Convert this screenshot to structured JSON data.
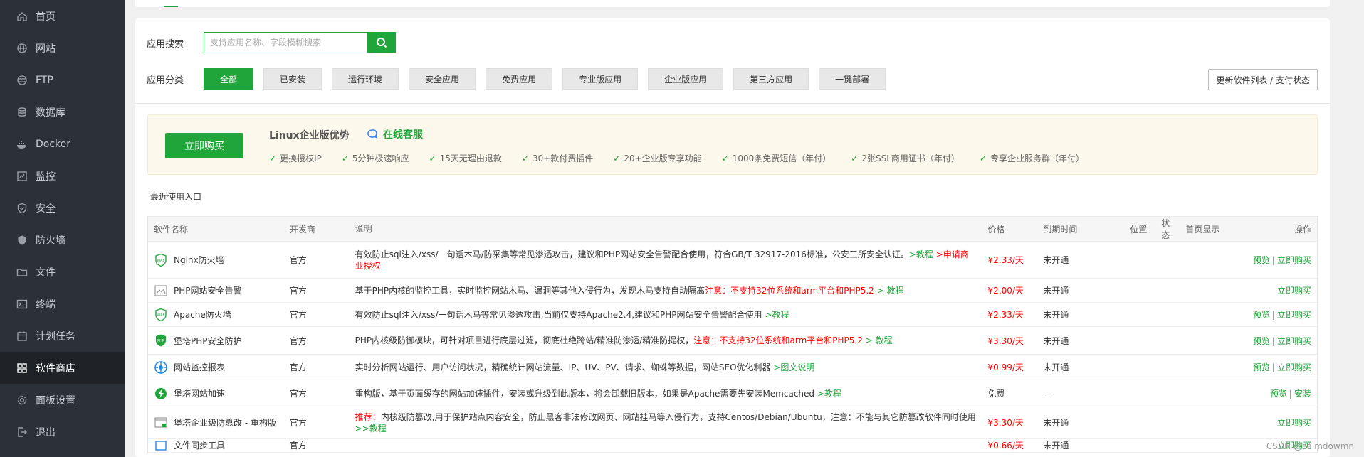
{
  "sidebar": {
    "items": [
      {
        "label": "首页",
        "icon": "home-icon"
      },
      {
        "label": "网站",
        "icon": "globe-icon"
      },
      {
        "label": "FTP",
        "icon": "ftp-icon"
      },
      {
        "label": "数据库",
        "icon": "database-icon"
      },
      {
        "label": "Docker",
        "icon": "docker-icon"
      },
      {
        "label": "监控",
        "icon": "monitor-icon"
      },
      {
        "label": "安全",
        "icon": "shield-icon"
      },
      {
        "label": "防火墙",
        "icon": "firewall-icon"
      },
      {
        "label": "文件",
        "icon": "folder-icon"
      },
      {
        "label": "终端",
        "icon": "terminal-icon"
      },
      {
        "label": "计划任务",
        "icon": "calendar-icon"
      },
      {
        "label": "软件商店",
        "icon": "apps-icon",
        "active": true
      },
      {
        "label": "面板设置",
        "icon": "gear-icon"
      },
      {
        "label": "退出",
        "icon": "logout-icon"
      }
    ]
  },
  "search": {
    "label": "应用搜索",
    "placeholder": "支持应用名称、字段模糊搜索"
  },
  "categories": {
    "label": "应用分类",
    "items": [
      "全部",
      "已安装",
      "运行环境",
      "安全应用",
      "免费应用",
      "专业版应用",
      "企业版应用",
      "第三方应用",
      "一键部署"
    ],
    "active": "全部"
  },
  "refresh_label": "更新软件列表 / 支付状态",
  "promo": {
    "buy_label": "立即购买",
    "title": "Linux企业版优势",
    "online_service": "在线客服",
    "features": [
      "更换授权IP",
      "5分钟极速响应",
      "15天无理由退款",
      "30+款付费插件",
      "20+企业版专享功能",
      "1000条免费短信（年付）",
      "2张SSL商用证书（年付）",
      "专享企业服务群（年付）"
    ]
  },
  "recent_label": "最近使用入口",
  "table": {
    "headers": {
      "name": "软件名称",
      "dev": "开发商",
      "desc": "说明",
      "price": "价格",
      "expire": "到期时间",
      "position": "位置",
      "status": "状态",
      "home": "首页显示",
      "ops": "操作"
    },
    "rows": [
      {
        "name": "Nginx防火墙",
        "icon": "waf-icon",
        "dev": "官方",
        "desc": "有效防止sql注入/xss/一句话木马/防采集等常见渗透攻击，建议和PHP网站安全告警配合使用，符合GB/T 32917-2016标准，公安三所安全认证。",
        "desc_green": ">教程",
        "desc_red": ">申请商业授权",
        "price": "¥2.33/天",
        "expire": "未开通",
        "ops": [
          "预览",
          "立即购买"
        ]
      },
      {
        "name": "PHP网站安全告警",
        "icon": "broken-image-icon",
        "dev": "官方",
        "desc": "基于PHP内核的监控工具，实时监控网站木马、漏洞等其他入侵行为，发现木马支持自动隔离",
        "desc_red": "注意：不支持32位系统和arm平台和PHP5.2",
        "desc_green": "> 教程",
        "price": "¥2.00/天",
        "expire": "未开通",
        "ops": [
          "立即购买"
        ]
      },
      {
        "name": "Apache防火墙",
        "icon": "waf-icon",
        "dev": "官方",
        "desc": "有效防止sql注入/xss/一句话木马等常见渗透攻击,当前仅支持Apache2.4,建议和PHP网站安全告警配合使用",
        "desc_green": ">教程",
        "price": "¥2.33/天",
        "expire": "未开通",
        "ops": [
          "预览",
          "立即购买"
        ]
      },
      {
        "name": "堡塔PHP安全防护",
        "icon": "php-shield-icon",
        "dev": "官方",
        "desc": "PHP内核级防御模块，可针对项目进行底层过滤，彻底杜绝跨站/精准防渗透/精准防提权，",
        "desc_red": "注意：不支持32位系统和arm平台和PHP5.2",
        "desc_green": "> 教程",
        "price": "¥3.30/天",
        "expire": "未开通",
        "ops": [
          "预览",
          "立即购买"
        ]
      },
      {
        "name": "网站监控报表",
        "icon": "report-icon",
        "dev": "官方",
        "desc": "实时分析网站运行、用户访问状况，精确统计网站流量、IP、UV、PV、请求、蜘蛛等数据，网站SEO优化利器",
        "desc_green": ">图文说明",
        "price": "¥0.99/天",
        "expire": "未开通",
        "ops": [
          "预览",
          "立即购买"
        ]
      },
      {
        "name": "堡塔网站加速",
        "icon": "bolt-icon",
        "dev": "官方",
        "desc": "重构版，基于页面缓存的网站加速插件，安装或升级到此版本，将会卸载旧版本，如果是Apache需要先安装Memcached",
        "desc_green": ">教程",
        "price": "免费",
        "expire": "--",
        "ops": [
          "预览",
          "安装"
        ]
      },
      {
        "name": "堡塔企业级防篡改 - 重构版",
        "icon": "tamper-icon",
        "dev": "官方",
        "desc_red_prefix": "推荐：",
        "desc": "内核级防篡改,用于保护站点内容安全，防止黑客非法修改网页、网站挂马等入侵行为，支持Centos/Debian/Ubuntu，注意：不能与其它防篡改软件同时使用",
        "desc_green": ">>教程",
        "price": "¥3.30/天",
        "expire": "未开通",
        "ops": [
          "立即购买"
        ]
      },
      {
        "name": "文件同步工具",
        "icon": "sync-icon",
        "dev": "官方",
        "desc": "",
        "price": "¥0.66/天",
        "expire": "未开通",
        "ops": [
          "立即购买"
        ]
      }
    ]
  },
  "watermark": "CSDN @calmdowmn",
  "colors": {
    "accent": "#20a53a",
    "sidebar_bg": "#2c3138",
    "price_red": "#ff0000"
  }
}
